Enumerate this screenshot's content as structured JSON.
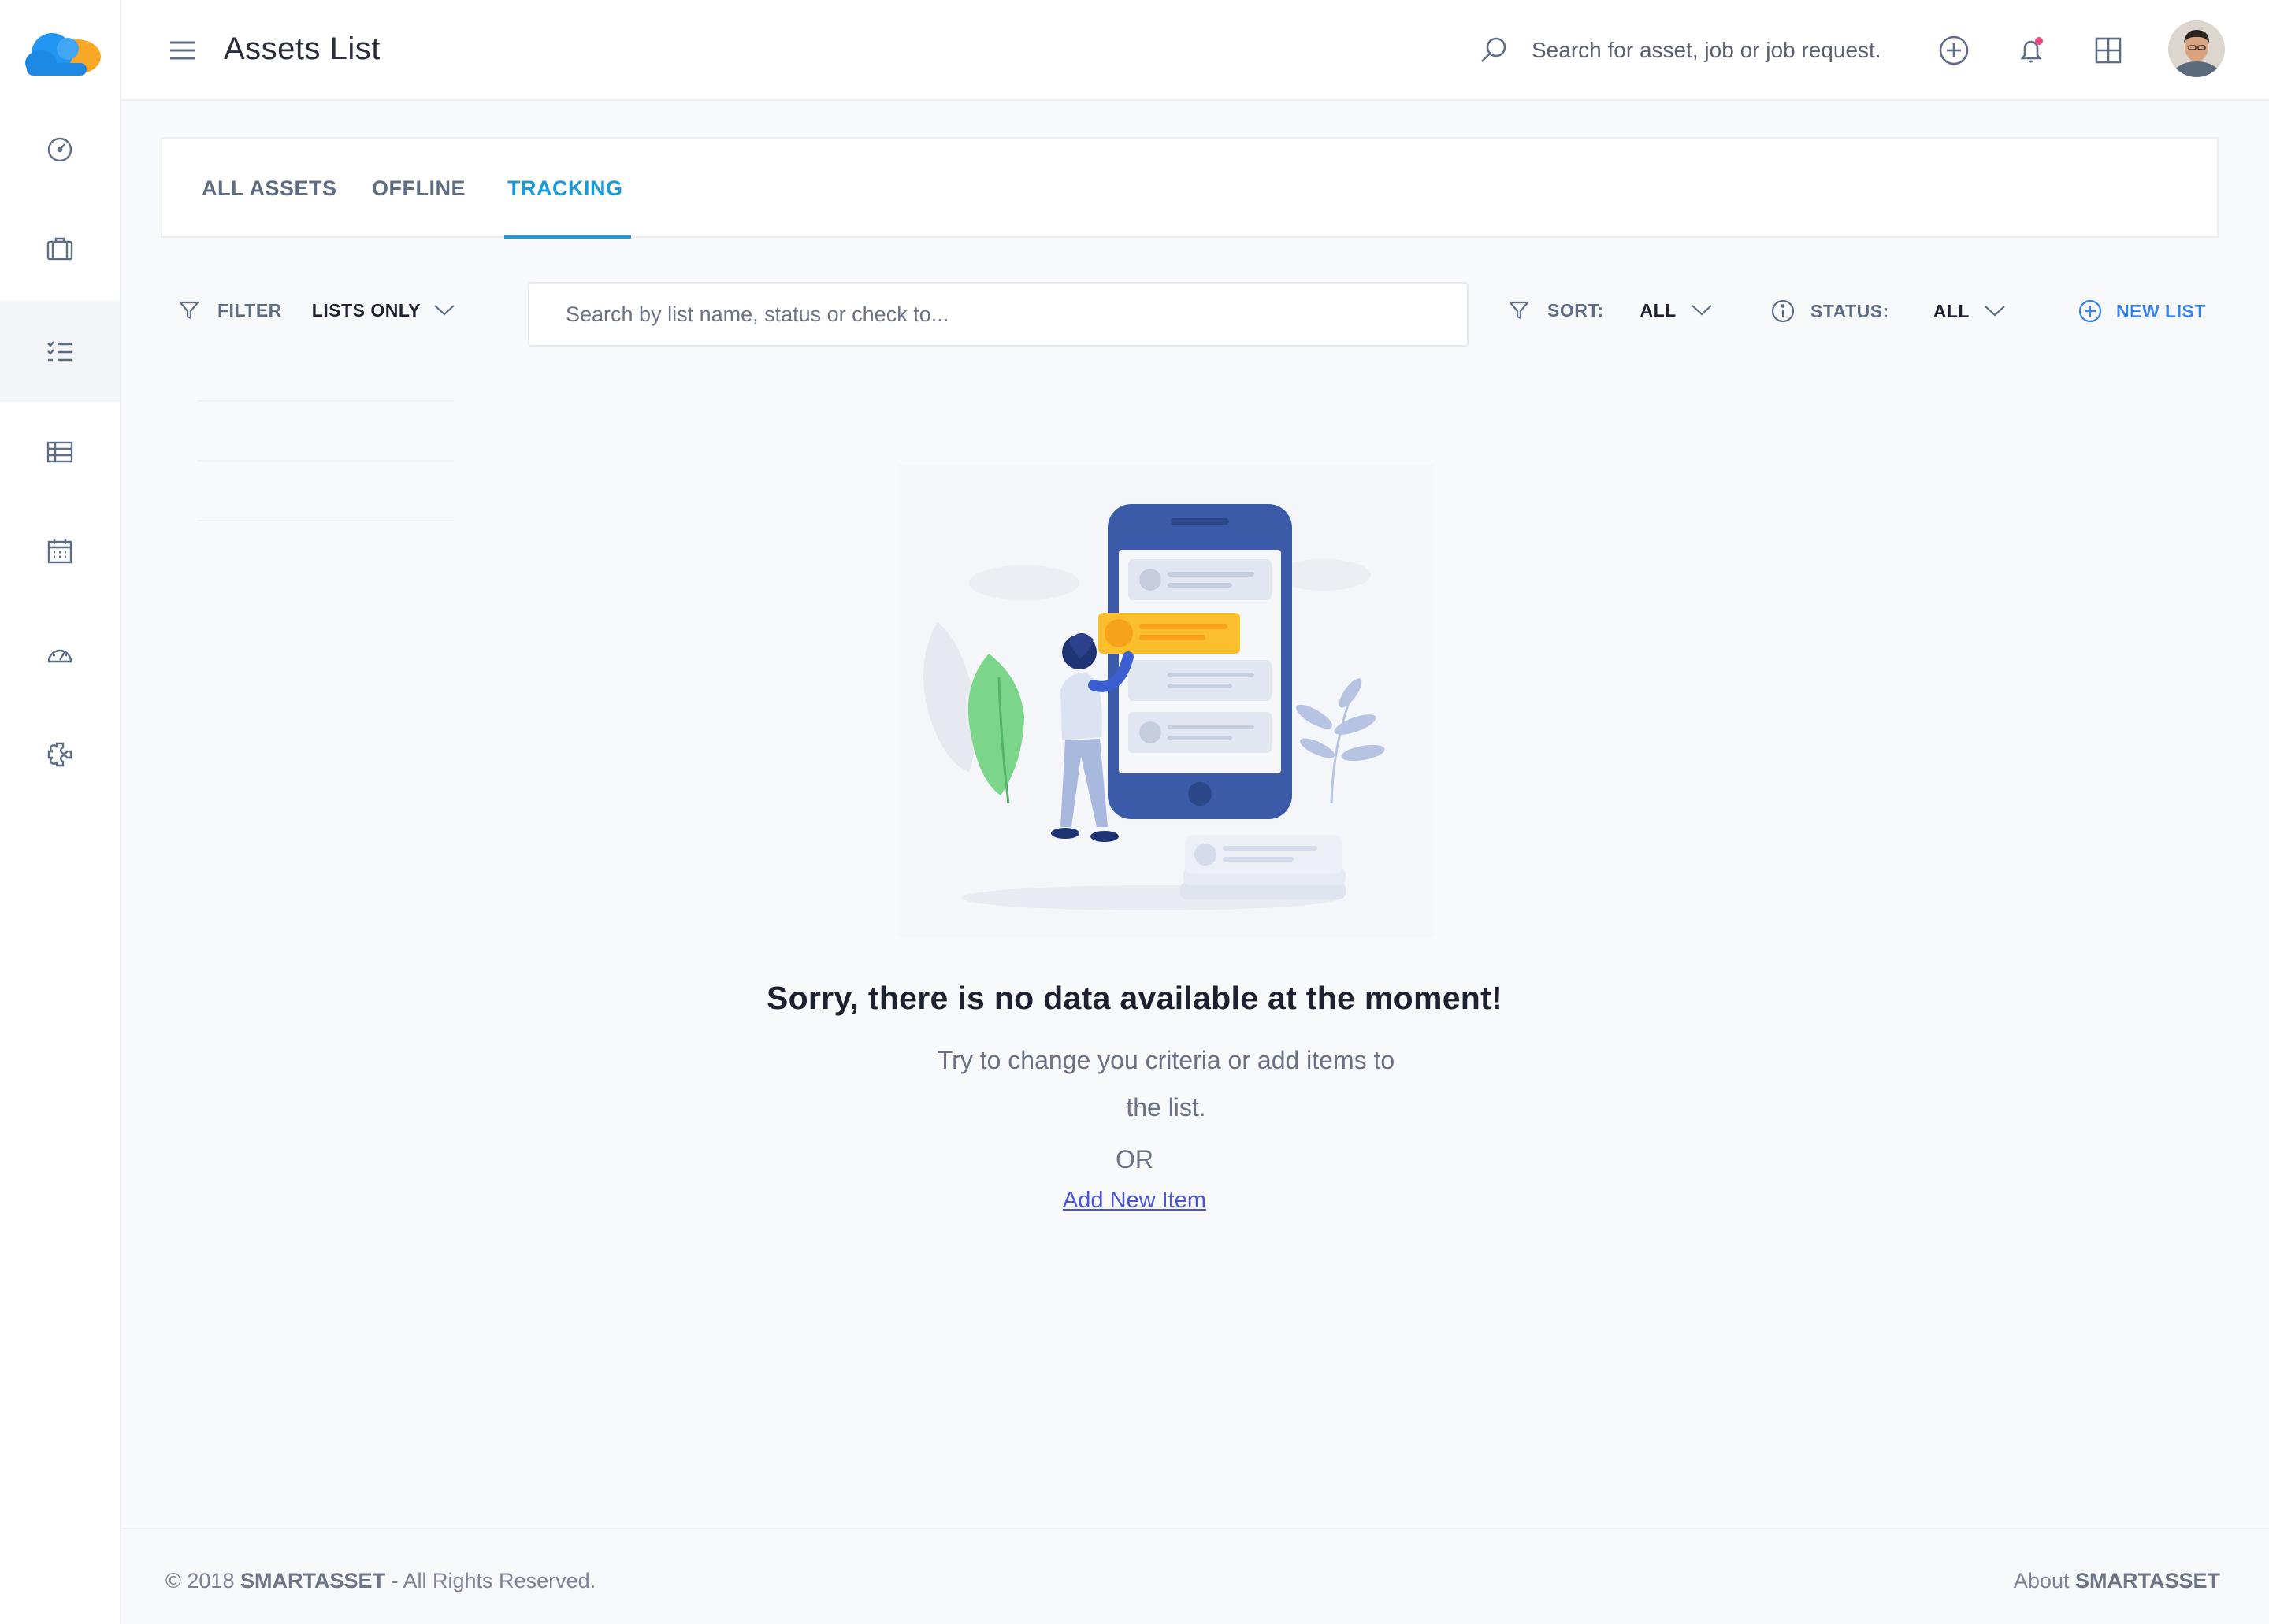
{
  "header": {
    "title": "Assets List",
    "search_placeholder": "Search for asset, job or job request."
  },
  "tabs": [
    {
      "label": "ALL ASSETS",
      "active": false
    },
    {
      "label": "OFFLINE",
      "active": false
    },
    {
      "label": "TRACKING",
      "active": true
    }
  ],
  "filters": {
    "filter_label": "FILTER",
    "filter_value": "LISTS ONLY",
    "search_placeholder": "Search by list name, status or check to...",
    "sort_label": "SORT:",
    "sort_value": "ALL",
    "status_label": "STATUS:",
    "status_value": "ALL",
    "new_list_label": "NEW LIST"
  },
  "empty_state": {
    "title": "Sorry, there is no data available at the moment!",
    "subtitle": "Try to change you criteria or add items to the list.",
    "or": "OR",
    "link": "Add New Item"
  },
  "footer": {
    "copyright_prefix": "© 2018",
    "brand": "SMARTASSET",
    "copyright_suffix": "- All Rights Reserved.",
    "about_prefix": "About",
    "about_brand": "SMARTASSET"
  },
  "sidebar": {
    "items": [
      {
        "icon": "dashboard-icon"
      },
      {
        "icon": "assets-icon"
      },
      {
        "icon": "checklist-icon",
        "active": true
      },
      {
        "icon": "table-icon"
      },
      {
        "icon": "calendar-icon"
      },
      {
        "icon": "gauge-icon"
      },
      {
        "icon": "settings-icon"
      }
    ]
  },
  "colors": {
    "accent": "#1a9bd8",
    "link": "#4a55d6",
    "new_list": "#3b82e6",
    "notification_dot": "#f0437a"
  }
}
